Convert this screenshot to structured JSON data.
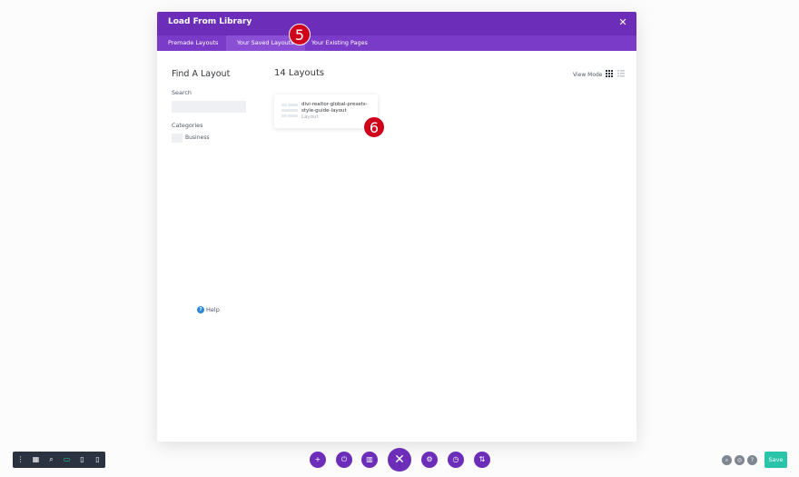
{
  "modal": {
    "title": "Load From Library",
    "close_glyph": "✕",
    "tabs": [
      {
        "label": "Premade Layouts"
      },
      {
        "label": "Your Saved Layouts"
      },
      {
        "label": "Your Existing Pages"
      }
    ]
  },
  "sidebar": {
    "find_title": "Find A Layout",
    "search_label": "Search",
    "search_value": "",
    "categories_label": "Categories",
    "categories": [
      {
        "label": "Business"
      }
    ],
    "help_label": "Help"
  },
  "main": {
    "count_label": "14 Layouts",
    "view_mode_label": "View Mode",
    "layouts": [
      {
        "name": "divi-realtor-global-presets-style-guide-layout",
        "type": "Layout"
      }
    ]
  },
  "annotations": {
    "first": "5",
    "second": "6"
  },
  "bottom_bar": {
    "save_label": "Save",
    "colors": {
      "purple": "#6c2eb9",
      "dark": "#2b3340",
      "green": "#29c4a9",
      "annotation": "#d0021b"
    }
  }
}
